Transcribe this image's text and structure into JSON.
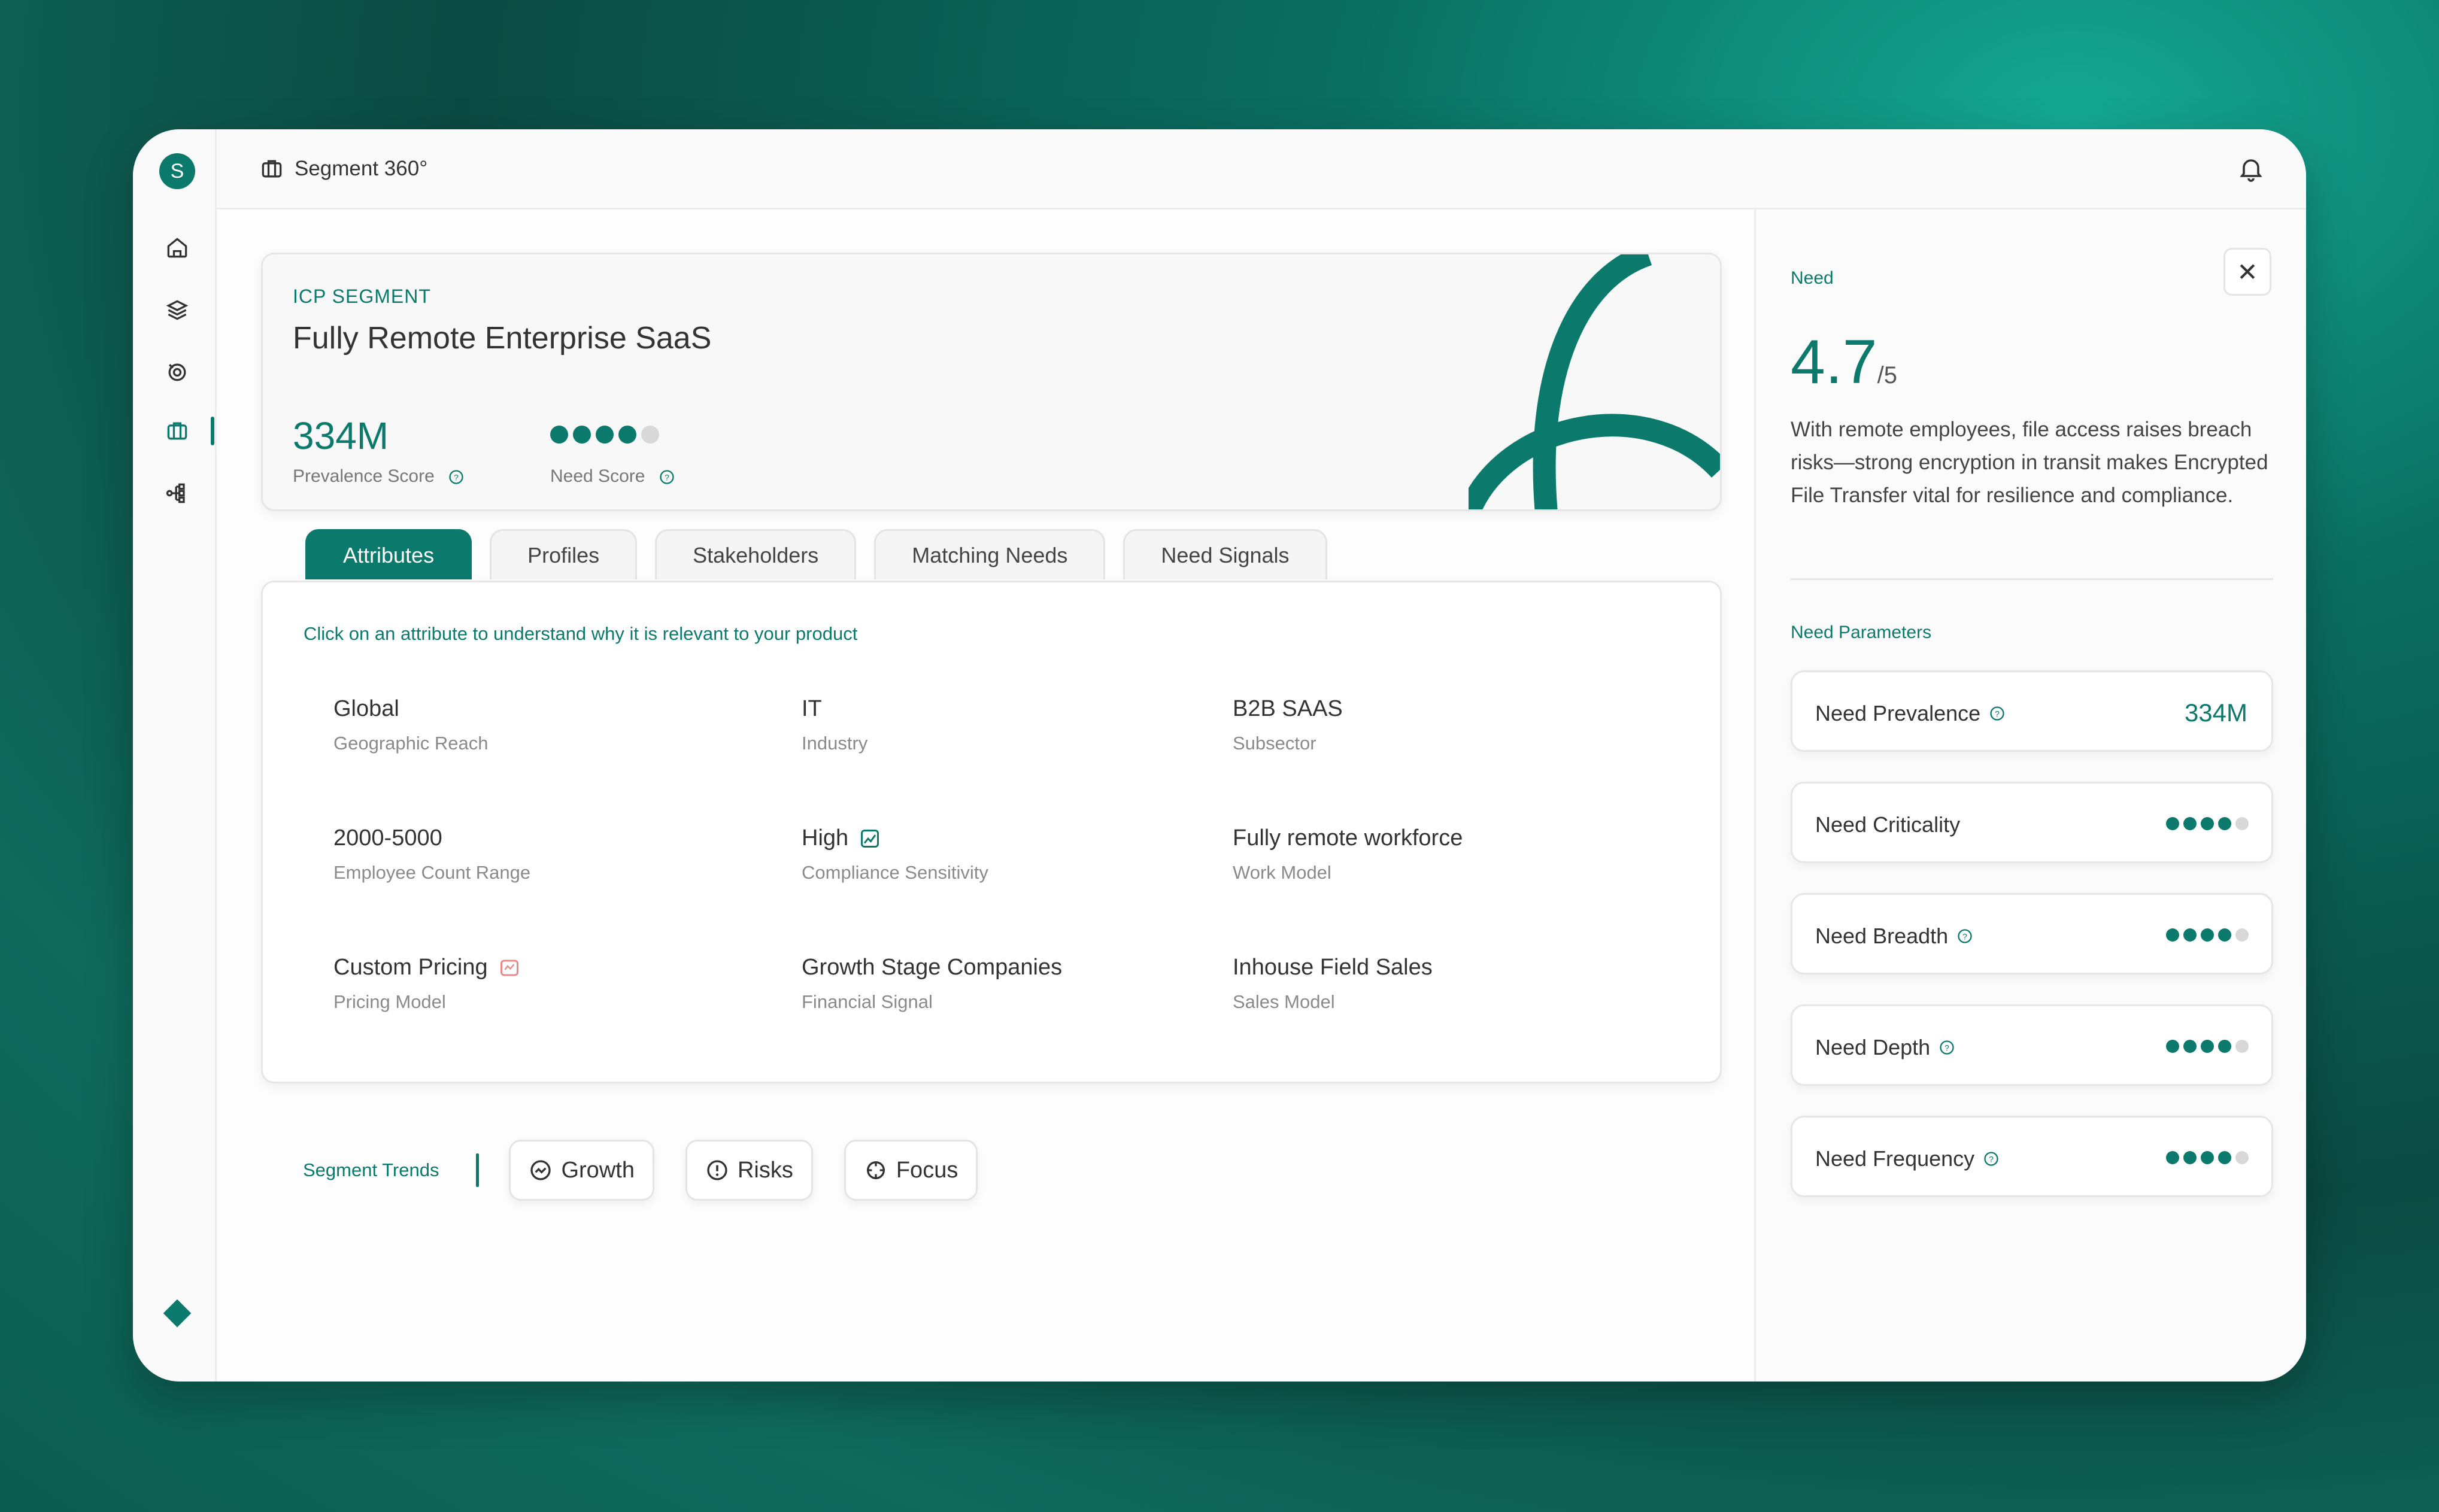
{
  "app": {
    "title": "Segment 360°",
    "avatar_letter": "S"
  },
  "rail": {
    "icons": [
      "home-icon",
      "layers-icon",
      "radar-icon",
      "briefcase-icon",
      "network-icon"
    ],
    "active": "briefcase-icon"
  },
  "hero": {
    "label": "ICP SEGMENT",
    "title": "Fully Remote Enterprise SaaS",
    "prevalence_value": "334M",
    "prevalence_label": "Prevalence Score",
    "need_label": "Need Score",
    "need_score": {
      "filled": 4,
      "total": 5
    }
  },
  "tabs": [
    {
      "label": "Attributes",
      "active": true
    },
    {
      "label": "Profiles",
      "active": false
    },
    {
      "label": "Stakeholders",
      "active": false
    },
    {
      "label": "Matching Needs",
      "active": false
    },
    {
      "label": "Need Signals",
      "active": false
    }
  ],
  "panel": {
    "hint": "Click on an attribute to understand why it is relevant to your product",
    "attributes": [
      {
        "value": "Global",
        "label": "Geographic Reach"
      },
      {
        "value": "IT",
        "label": "Industry"
      },
      {
        "value": "B2B SAAS",
        "label": "Subsector"
      },
      {
        "value": "2000-5000",
        "label": "Employee Count Range"
      },
      {
        "value": "High",
        "label": "Compliance Sensitivity",
        "icon": "chart-image-icon"
      },
      {
        "value": "Fully remote workforce",
        "label": "Work Model"
      },
      {
        "value": "Custom Pricing",
        "label": "Pricing Model",
        "icon": "pricing-tag-icon"
      },
      {
        "value": "Growth Stage Companies",
        "label": "Financial Signal"
      },
      {
        "value": "Inhouse Field Sales",
        "label": "Sales Model"
      }
    ]
  },
  "trends": {
    "label": "Segment Trends",
    "buttons": [
      {
        "label": "Growth",
        "icon": "growth-icon"
      },
      {
        "label": "Risks",
        "icon": "alert-icon"
      },
      {
        "label": "Focus",
        "icon": "crosshair-icon"
      }
    ]
  },
  "side": {
    "section": "Need",
    "score_value": "4.7",
    "score_suffix": "/5",
    "description": "With remote employees, file access raises breach risks—strong encryption in transit makes Encrypted File Transfer vital for resilience and compliance.",
    "params_title": "Need Parameters",
    "params": [
      {
        "label": "Need Prevalence",
        "help": true,
        "value": "334M"
      },
      {
        "label": "Need Criticality",
        "help": false,
        "dots": 4
      },
      {
        "label": "Need Breadth",
        "help": true,
        "dots": 4
      },
      {
        "label": "Need Depth",
        "help": true,
        "dots": 4
      },
      {
        "label": "Need Frequency",
        "help": true,
        "dots": 4
      }
    ]
  },
  "colors": {
    "accent": "#0b7a6c",
    "muted": "#8a8a8a",
    "border": "#e6e6e6"
  }
}
